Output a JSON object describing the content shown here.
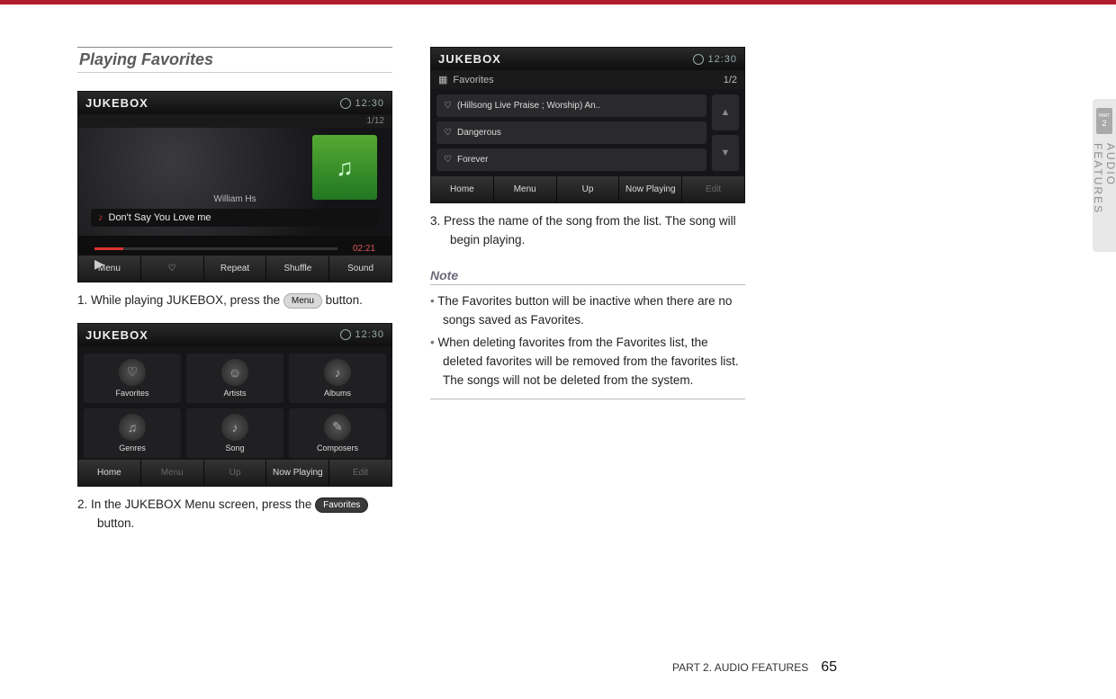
{
  "side_tab": {
    "part_prefix": "PART",
    "part_num": "2",
    "label": "AUDIO FEATURES"
  },
  "section_title": "Playing Favorites",
  "screenshots": {
    "nowplaying": {
      "title": "JUKEBOX",
      "time": "12:30",
      "page_index": "1/12",
      "artist": "William Hs",
      "track": "Don't Say You Love me",
      "duration": "02:21",
      "bottombar": [
        "Menu",
        "♡",
        "Repeat",
        "Shuffle",
        "Sound"
      ]
    },
    "menu": {
      "title": "JUKEBOX",
      "time": "12:30",
      "grid": [
        "Favorites",
        "Artists",
        "Albums",
        "Genres",
        "Song",
        "Composers"
      ],
      "bottombar": [
        "Home",
        "Menu",
        "Up",
        "Now Playing",
        "Edit"
      ]
    },
    "favlist": {
      "title": "JUKEBOX",
      "time": "12:30",
      "crumb": "Favorites",
      "page_index": "1/2",
      "items": [
        "(Hillsong Live Praise ; Worship) An..",
        "Dangerous",
        "Forever"
      ],
      "bottombar": [
        "Home",
        "Menu",
        "Up",
        "Now Playing",
        "Edit"
      ]
    }
  },
  "steps": {
    "s1a": "1. While playing JUKEBOX, press the ",
    "s1_btn": "Menu",
    "s1b": " button.",
    "s2a": "2. In the JUKEBOX Menu screen, press the ",
    "s2_btn": "Favorites",
    "s2b": " button.",
    "s3": "3. Press the name of the song from the list. The song will begin playing."
  },
  "note": {
    "heading": "Note",
    "items": [
      "The Favorites button will be inactive when there are no songs saved as Favorites.",
      "When deleting favorites from the Favorites list, the deleted favorites will be removed from the favorites list. The songs will not be deleted from the system."
    ]
  },
  "footer": {
    "label": "PART 2. AUDIO FEATURES",
    "page": "65"
  }
}
